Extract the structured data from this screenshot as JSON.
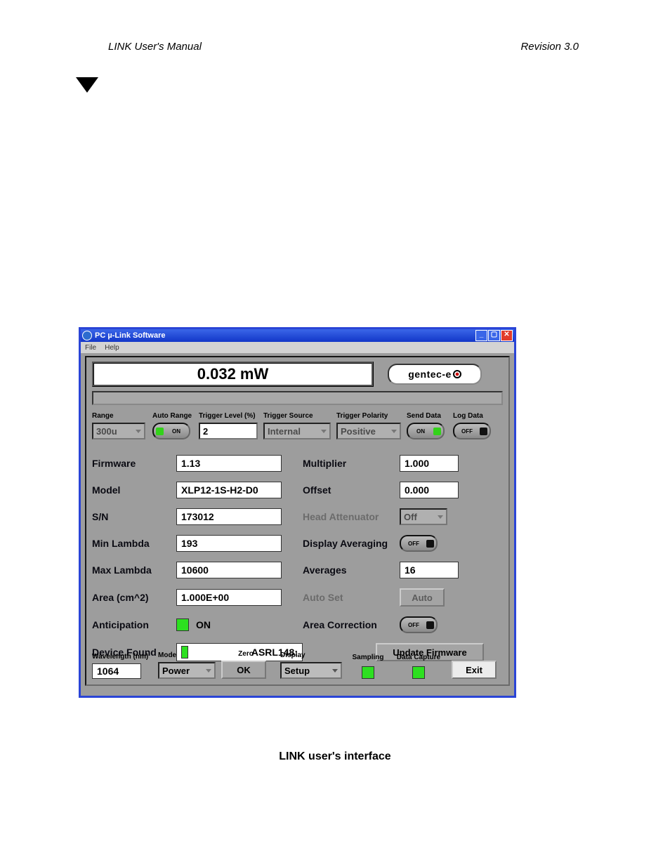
{
  "page_header": {
    "left": "LINK User's Manual",
    "right": "Revision 3.0"
  },
  "caption": "LINK user's interface",
  "window": {
    "title": "PC µ-Link Software",
    "menu": {
      "file": "File",
      "help": "Help"
    },
    "win_controls": {
      "min": "minimize",
      "max": "maximize",
      "close": "close"
    }
  },
  "display": {
    "reading": "0.032 mW",
    "brand": "gentec-e"
  },
  "controls": {
    "range": {
      "label": "Range",
      "value": "300u"
    },
    "auto_range": {
      "label": "Auto Range",
      "state": "ON"
    },
    "trigger_level": {
      "label": "Trigger Level (%)",
      "value": "2"
    },
    "trigger_source": {
      "label": "Trigger Source",
      "value": "Internal"
    },
    "trigger_polarity": {
      "label": "Trigger Polarity",
      "value": "Positive"
    },
    "send_data": {
      "label": "Send Data",
      "state": "ON"
    },
    "log_data": {
      "label": "Log Data",
      "state": "OFF"
    }
  },
  "info": {
    "firmware": {
      "label": "Firmware",
      "value": "1.13"
    },
    "model": {
      "label": "Model",
      "value": "XLP12-1S-H2-D0"
    },
    "sn": {
      "label": "S/N",
      "value": "173012"
    },
    "min_lambda": {
      "label": "Min Lambda",
      "value": "193"
    },
    "max_lambda": {
      "label": "Max Lambda",
      "value": "10600"
    },
    "area": {
      "label": "Area (cm^2)",
      "value": "1.000E+00"
    },
    "anticipation": {
      "label": "Anticipation",
      "state": "ON"
    },
    "multiplier": {
      "label": "Multiplier",
      "value": "1.000"
    },
    "offset": {
      "label": "Offset",
      "value": "0.000"
    },
    "head_atten": {
      "label": "Head Attenuator",
      "value": "Off"
    },
    "disp_avg": {
      "label": "Display Averaging",
      "state": "OFF"
    },
    "averages": {
      "label": "Averages",
      "value": "16"
    },
    "auto_set": {
      "label": "Auto Set",
      "button": "Auto"
    },
    "area_corr": {
      "label": "Area Correction",
      "state": "OFF"
    },
    "device_found": {
      "label": "Device Found",
      "value": "ASRL148:"
    },
    "update_fw": {
      "button": "Update Firmware"
    }
  },
  "bottom": {
    "wavelength": {
      "label": "Wavelength (nm)",
      "value": "1064"
    },
    "mode": {
      "label": "Mode",
      "value": "Power"
    },
    "zero": {
      "label": "Zero",
      "button": "OK"
    },
    "display": {
      "label": "Display",
      "value": "Setup"
    },
    "sampling": {
      "label": "Sampling"
    },
    "capture": {
      "label": "Data Capture"
    },
    "exit": {
      "button": "Exit"
    }
  }
}
